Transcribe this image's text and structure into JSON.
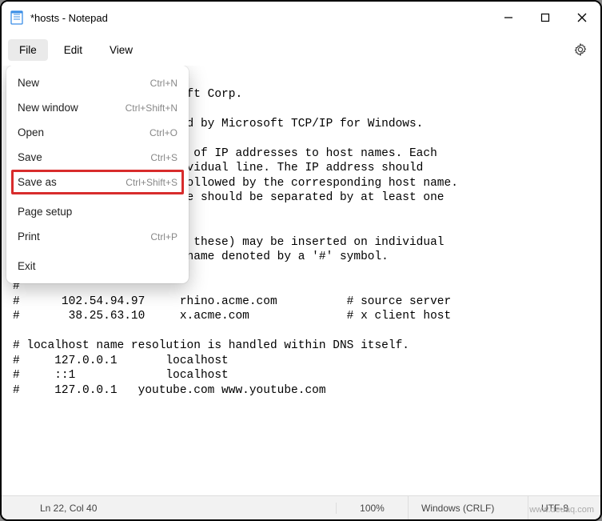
{
  "window": {
    "title": "*hosts - Notepad"
  },
  "menubar": {
    "file": "File",
    "edit": "Edit",
    "view": "View"
  },
  "file_menu": {
    "new": {
      "label": "New",
      "shortcut": "Ctrl+N"
    },
    "new_window": {
      "label": "New window",
      "shortcut": "Ctrl+Shift+N"
    },
    "open": {
      "label": "Open",
      "shortcut": "Ctrl+O"
    },
    "save": {
      "label": "Save",
      "shortcut": "Ctrl+S"
    },
    "save_as": {
      "label": "Save as",
      "shortcut": "Ctrl+Shift+S"
    },
    "page_setup": {
      "label": "Page setup",
      "shortcut": ""
    },
    "print": {
      "label": "Print",
      "shortcut": "Ctrl+P"
    },
    "exit": {
      "label": "Exit",
      "shortcut": ""
    }
  },
  "editor": {
    "text": "\n                   icrosoft Corp.\n\n                   le used by Microsoft TCP/IP for Windows.\n\n                   ppings of IP addresses to host names. Each\n                   n individual line. The IP address should\n                   lumn followed by the corresponding host name.\n                   st name should be separated by at least one\n\n\n                   uch as these) may be inserted on individual\n                   chine name denoted by a '#' symbol.\n\n#\n#      102.54.94.97     rhino.acme.com          # source server\n#       38.25.63.10     x.acme.com              # x client host\n\n# localhost name resolution is handled within DNS itself.\n#     127.0.0.1       localhost\n#     ::1             localhost\n#     127.0.0.1   youtube.com www.youtube.com"
  },
  "statusbar": {
    "position": "Ln 22, Col 40",
    "zoom": "100%",
    "line_ending": "Windows (CRLF)",
    "encoding": "UTF-8"
  },
  "watermark": "www.deuaq.com"
}
